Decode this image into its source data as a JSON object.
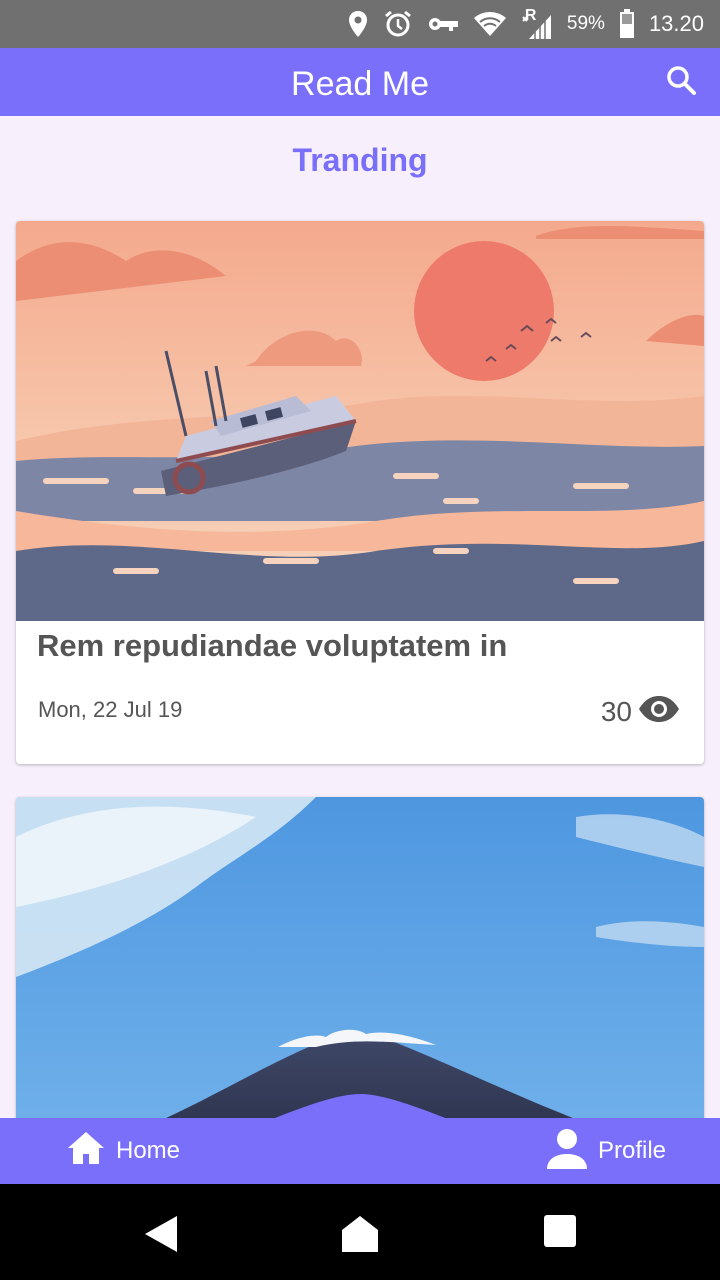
{
  "status_bar": {
    "icons": [
      "location-icon",
      "alarm-icon",
      "vpn-key-icon",
      "wifi-icon",
      "cellular-signal-icon",
      "battery-icon"
    ],
    "network_label": "R",
    "battery": "59%",
    "time": "13.20"
  },
  "app_bar": {
    "title": "Read Me",
    "search_icon": "search-icon"
  },
  "section": {
    "title": "Tranding"
  },
  "articles": [
    {
      "title": "Rem repudiandae voluptatem in",
      "date": "Mon, 22 Jul 19",
      "views": "30",
      "image": "illustration-boat-at-sea-sunset",
      "views_icon": "eye-icon"
    },
    {
      "image": "photo-volcano-mountain-blue-sky"
    }
  ],
  "bottom_nav": {
    "home_label": "Home",
    "profile_label": "Profile",
    "home_icon": "home-icon",
    "profile_icon": "person-icon"
  },
  "system_nav": {
    "buttons": [
      "back-icon",
      "home-circle-icon",
      "recents-icon"
    ]
  },
  "colors": {
    "primary": "#7A6FFA",
    "background": "#F7EFFB",
    "status_bar": "#707070",
    "text": "#555555"
  }
}
